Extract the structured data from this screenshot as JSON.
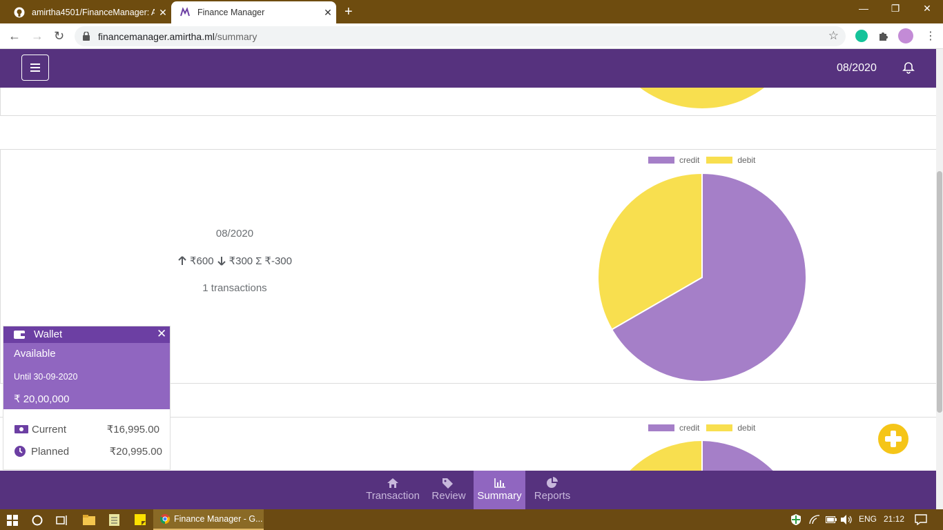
{
  "browser": {
    "tabs": [
      {
        "title": "amirtha4501/FinanceManager: A",
        "active": false
      },
      {
        "title": "Finance Manager",
        "active": true
      }
    ],
    "url_host": "financemanager.amirtha.ml",
    "url_path": "/summary"
  },
  "header": {
    "date": "08/2020"
  },
  "summary": {
    "period": "08/2020",
    "credit": "₹600",
    "debit": "₹300",
    "sigma": "Σ",
    "total": "₹-300",
    "transactions": "1 transactions"
  },
  "chart_data": [
    {
      "type": "pie",
      "labels": [
        "credit",
        "debit"
      ],
      "values": [
        600,
        300
      ],
      "colors": [
        "#a57fc8",
        "#f8df4f"
      ],
      "legend_position": "top"
    },
    {
      "type": "pie",
      "labels": [
        "credit",
        "debit"
      ],
      "colors": [
        "#a57fc8",
        "#f8df4f"
      ],
      "legend_position": "top"
    }
  ],
  "wallet": {
    "title": "Wallet",
    "available_label": "Available",
    "until": "Until 30-09-2020",
    "amount": "₹ 20,00,000",
    "current_label": "Current",
    "current_value": "₹16,995.00",
    "planned_label": "Planned",
    "planned_value": "₹20,995.00"
  },
  "nav": [
    {
      "label": "Transaction",
      "icon": "home-icon"
    },
    {
      "label": "Review",
      "icon": "tags-icon"
    },
    {
      "label": "Summary",
      "icon": "bar-chart-icon",
      "active": true
    },
    {
      "label": "Reports",
      "icon": "pie-chart-icon"
    }
  ],
  "taskbar": {
    "chrome_label": "Finance Manager - G...",
    "lang": "ENG",
    "time": "21:12"
  },
  "colors": {
    "primary": "#56327e",
    "wallet_header": "#6c3fa3",
    "wallet_body": "#9066c0",
    "credit": "#a57fc8",
    "debit": "#f8df4f",
    "fab": "#f5c518"
  }
}
